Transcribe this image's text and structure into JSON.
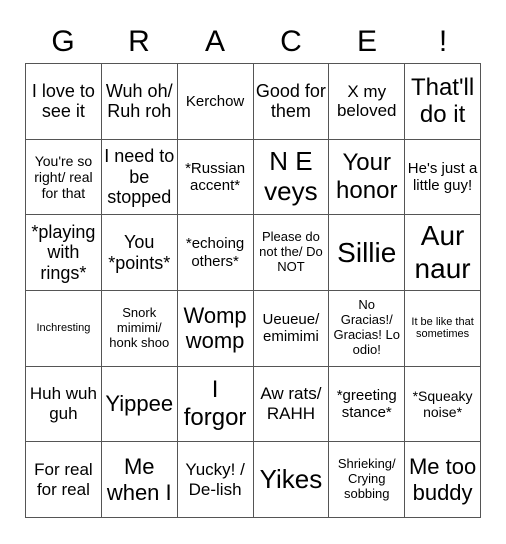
{
  "title_letters": [
    "G",
    "R",
    "A",
    "C",
    "E",
    "!"
  ],
  "rows": [
    [
      "I love to see it",
      "Wuh oh/ Ruh roh",
      "Kerchow",
      "Good for them",
      "X my beloved",
      "That'll do it"
    ],
    [
      "You're so right/ real for that",
      "I need to be stopped",
      "*Russian accent*",
      "N E veys",
      "Your honor",
      "He's just a little guy!"
    ],
    [
      "*playing with rings*",
      "You *points*",
      "*echoing others*",
      "Please do not the/ Do NOT",
      "Sillie",
      "Aur naur"
    ],
    [
      "Inchresting",
      "Snork mimimi/ honk shoo",
      "Womp womp",
      "Ueueue/ emimimi",
      "No Gracias!/ Gracias! Lo odio!",
      "It be like that sometimes"
    ],
    [
      "Huh wuh guh",
      "Yippee",
      "I forgor",
      "Aw rats/ RAHH",
      "*greeting stance*",
      "*Squeaky noise*"
    ],
    [
      "For real for real",
      "Me when I",
      "Yucky! / De-lish",
      "Yikes",
      "Shrieking/ Crying sobbing",
      "Me too buddy"
    ]
  ]
}
